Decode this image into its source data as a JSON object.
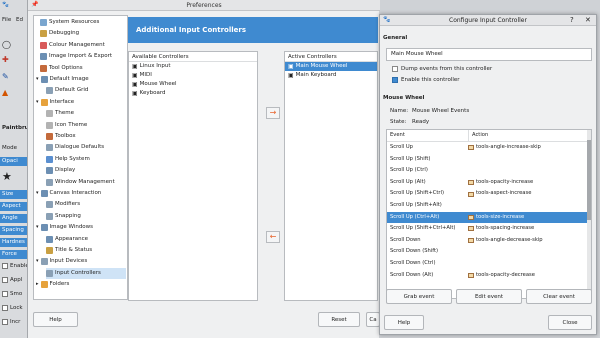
{
  "gimp": {
    "menu_file": "File",
    "menu_edit": "Ed",
    "labels": [
      "Paintbru",
      "Mode",
      "Opaci"
    ],
    "bars": [
      "Size",
      "Aspect",
      "Angle",
      "Spacing",
      "Hardnes",
      "Force"
    ],
    "checks": [
      "Enable",
      "Appl",
      "Smo",
      "Lock",
      "Incr"
    ]
  },
  "prefs": {
    "title": "Preferences",
    "banner": "Additional Input Controllers",
    "tree": [
      {
        "label": "System Resources",
        "indent": 1,
        "color": "#7aa6cf"
      },
      {
        "label": "Debugging",
        "indent": 1,
        "color": "#c9a043"
      },
      {
        "label": "Colour Management",
        "indent": 1,
        "color": "#d85a5a"
      },
      {
        "label": "Image Import & Export",
        "indent": 1,
        "color": "#6c8fb3"
      },
      {
        "label": "Tool Options",
        "indent": 1,
        "color": "#c46a3c"
      },
      {
        "label": "Default Image",
        "indent": 0,
        "color": "#6c8fb3",
        "exp": "▾"
      },
      {
        "label": "Default Grid",
        "indent": 2,
        "color": "#8aa0b5"
      },
      {
        "label": "Interface",
        "indent": 0,
        "color": "#e6a23c",
        "exp": "▾"
      },
      {
        "label": "Theme",
        "indent": 2,
        "color": "#b3b3b3"
      },
      {
        "label": "Icon Theme",
        "indent": 2,
        "color": "#b3b3b3"
      },
      {
        "label": "Toolbox",
        "indent": 2,
        "color": "#c46a3c"
      },
      {
        "label": "Dialogue Defaults",
        "indent": 2,
        "color": "#8aa0b5"
      },
      {
        "label": "Help System",
        "indent": 2,
        "color": "#5a8fd0"
      },
      {
        "label": "Display",
        "indent": 2,
        "color": "#6c8fb3"
      },
      {
        "label": "Window Management",
        "indent": 2,
        "color": "#8aa0b5"
      },
      {
        "label": "Canvas Interaction",
        "indent": 0,
        "color": "#6c8fb3",
        "exp": "▾"
      },
      {
        "label": "Modifiers",
        "indent": 2,
        "color": "#8aa0b5"
      },
      {
        "label": "Snapping",
        "indent": 2,
        "color": "#8aa0b5"
      },
      {
        "label": "Image Windows",
        "indent": 0,
        "color": "#6c8fb3",
        "exp": "▾"
      },
      {
        "label": "Appearance",
        "indent": 2,
        "color": "#6c8fb3"
      },
      {
        "label": "Title & Status",
        "indent": 2,
        "color": "#c9a043"
      },
      {
        "label": "Input Devices",
        "indent": 0,
        "color": "#8aa0b5",
        "exp": "▾"
      },
      {
        "label": "Input Controllers",
        "indent": 2,
        "color": "#8aa0b5",
        "sel": true
      },
      {
        "label": "Folders",
        "indent": 0,
        "color": "#e6a23c",
        "exp": "▸"
      }
    ],
    "available_header": "Available Controllers",
    "available": [
      "Linux Input",
      "MIDI",
      "Mouse Wheel",
      "Keyboard"
    ],
    "active_header": "Active Controllers",
    "active": [
      "Main Mouse Wheel",
      "Main Keyboard"
    ],
    "help": "Help",
    "reset": "Reset",
    "cancel": "Ca"
  },
  "dialog": {
    "title": "Configure Input Controller",
    "general": "General",
    "name_value": "Main Mouse Wheel",
    "dump_label": "Dump events from this controller",
    "enable_label": "Enable this controller",
    "section": "Mouse Wheel",
    "name_label": "Name:",
    "name_text": "Mouse Wheel Events",
    "state_label": "State:",
    "state_text": "Ready",
    "col_event": "Event",
    "col_action": "Action",
    "rows": [
      {
        "event": "Scroll Up",
        "action": "tools-angle-increase-skip"
      },
      {
        "event": "Scroll Up (Shift)",
        "action": ""
      },
      {
        "event": "Scroll Up (Ctrl)",
        "action": ""
      },
      {
        "event": "Scroll Up (Alt)",
        "action": "tools-opacity-increase"
      },
      {
        "event": "Scroll Up (Shift+Ctrl)",
        "action": "tools-aspect-increase"
      },
      {
        "event": "Scroll Up (Shift+Alt)",
        "action": ""
      },
      {
        "event": "Scroll Up (Ctrl+Alt)",
        "action": "tools-size-increase",
        "sel": true
      },
      {
        "event": "Scroll Up (Shift+Ctrl+Alt)",
        "action": "tools-spacing-increase"
      },
      {
        "event": "Scroll Down",
        "action": "tools-angle-decrease-skip"
      },
      {
        "event": "Scroll Down (Shift)",
        "action": ""
      },
      {
        "event": "Scroll Down (Ctrl)",
        "action": ""
      },
      {
        "event": "Scroll Down (Alt)",
        "action": "tools-opacity-decrease"
      }
    ],
    "grab": "Grab event",
    "edit": "Edit event",
    "clear": "Clear event",
    "help": "Help",
    "close": "Close"
  }
}
